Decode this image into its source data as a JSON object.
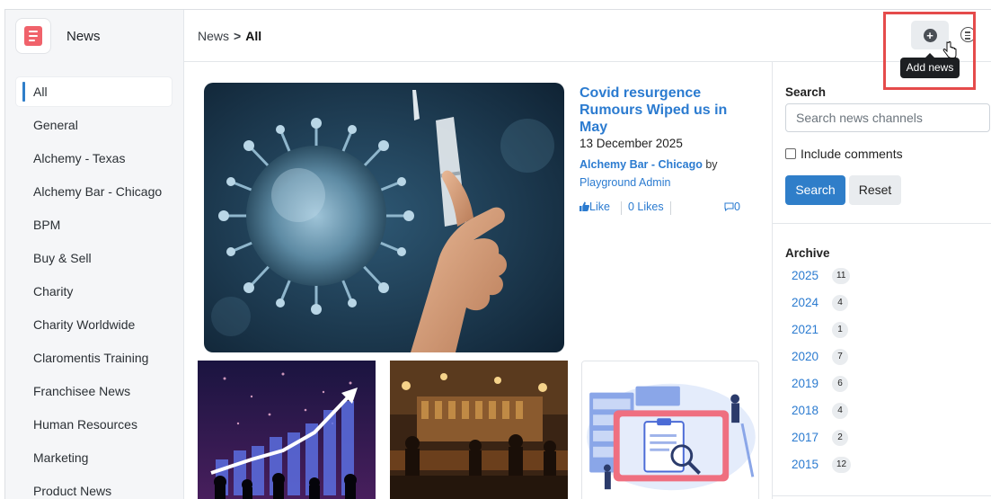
{
  "header": {
    "app_name": "News",
    "breadcrumb": {
      "root": "News",
      "separator": ">",
      "current": "All"
    },
    "add_tooltip": "Add news"
  },
  "sidebar": {
    "items": [
      {
        "label": "All",
        "active": true
      },
      {
        "label": "General"
      },
      {
        "label": "Alchemy - Texas"
      },
      {
        "label": "Alchemy Bar - Chicago"
      },
      {
        "label": "BPM"
      },
      {
        "label": "Buy & Sell"
      },
      {
        "label": "Charity"
      },
      {
        "label": "Charity Worldwide"
      },
      {
        "label": "Claromentis Training"
      },
      {
        "label": "Franchisee News"
      },
      {
        "label": "Human Resources"
      },
      {
        "label": "Marketing"
      },
      {
        "label": "Product News"
      }
    ]
  },
  "featured": {
    "title": "Covid resurgence Rumours Wiped us in May",
    "date": "13 December 2025",
    "channel": "Alchemy Bar - Chicago",
    "by": "by",
    "author": "Playground Admin",
    "like_label": "Like",
    "likes": "0 Likes",
    "comments": "0"
  },
  "search_panel": {
    "heading": "Search",
    "placeholder": "Search news channels",
    "include_comments": "Include comments",
    "search_button": "Search",
    "reset_button": "Reset"
  },
  "archive": {
    "heading": "Archive",
    "years": [
      {
        "year": "2025",
        "count": "11"
      },
      {
        "year": "2024",
        "count": "4"
      },
      {
        "year": "2021",
        "count": "1"
      },
      {
        "year": "2020",
        "count": "7"
      },
      {
        "year": "2019",
        "count": "6"
      },
      {
        "year": "2018",
        "count": "4"
      },
      {
        "year": "2017",
        "count": "2"
      },
      {
        "year": "2015",
        "count": "12"
      }
    ]
  },
  "colors": {
    "accent": "#2f7ec9",
    "link": "#2b7bd0",
    "highlight": "#e54b4b",
    "brand_icon": "#f0626b"
  }
}
